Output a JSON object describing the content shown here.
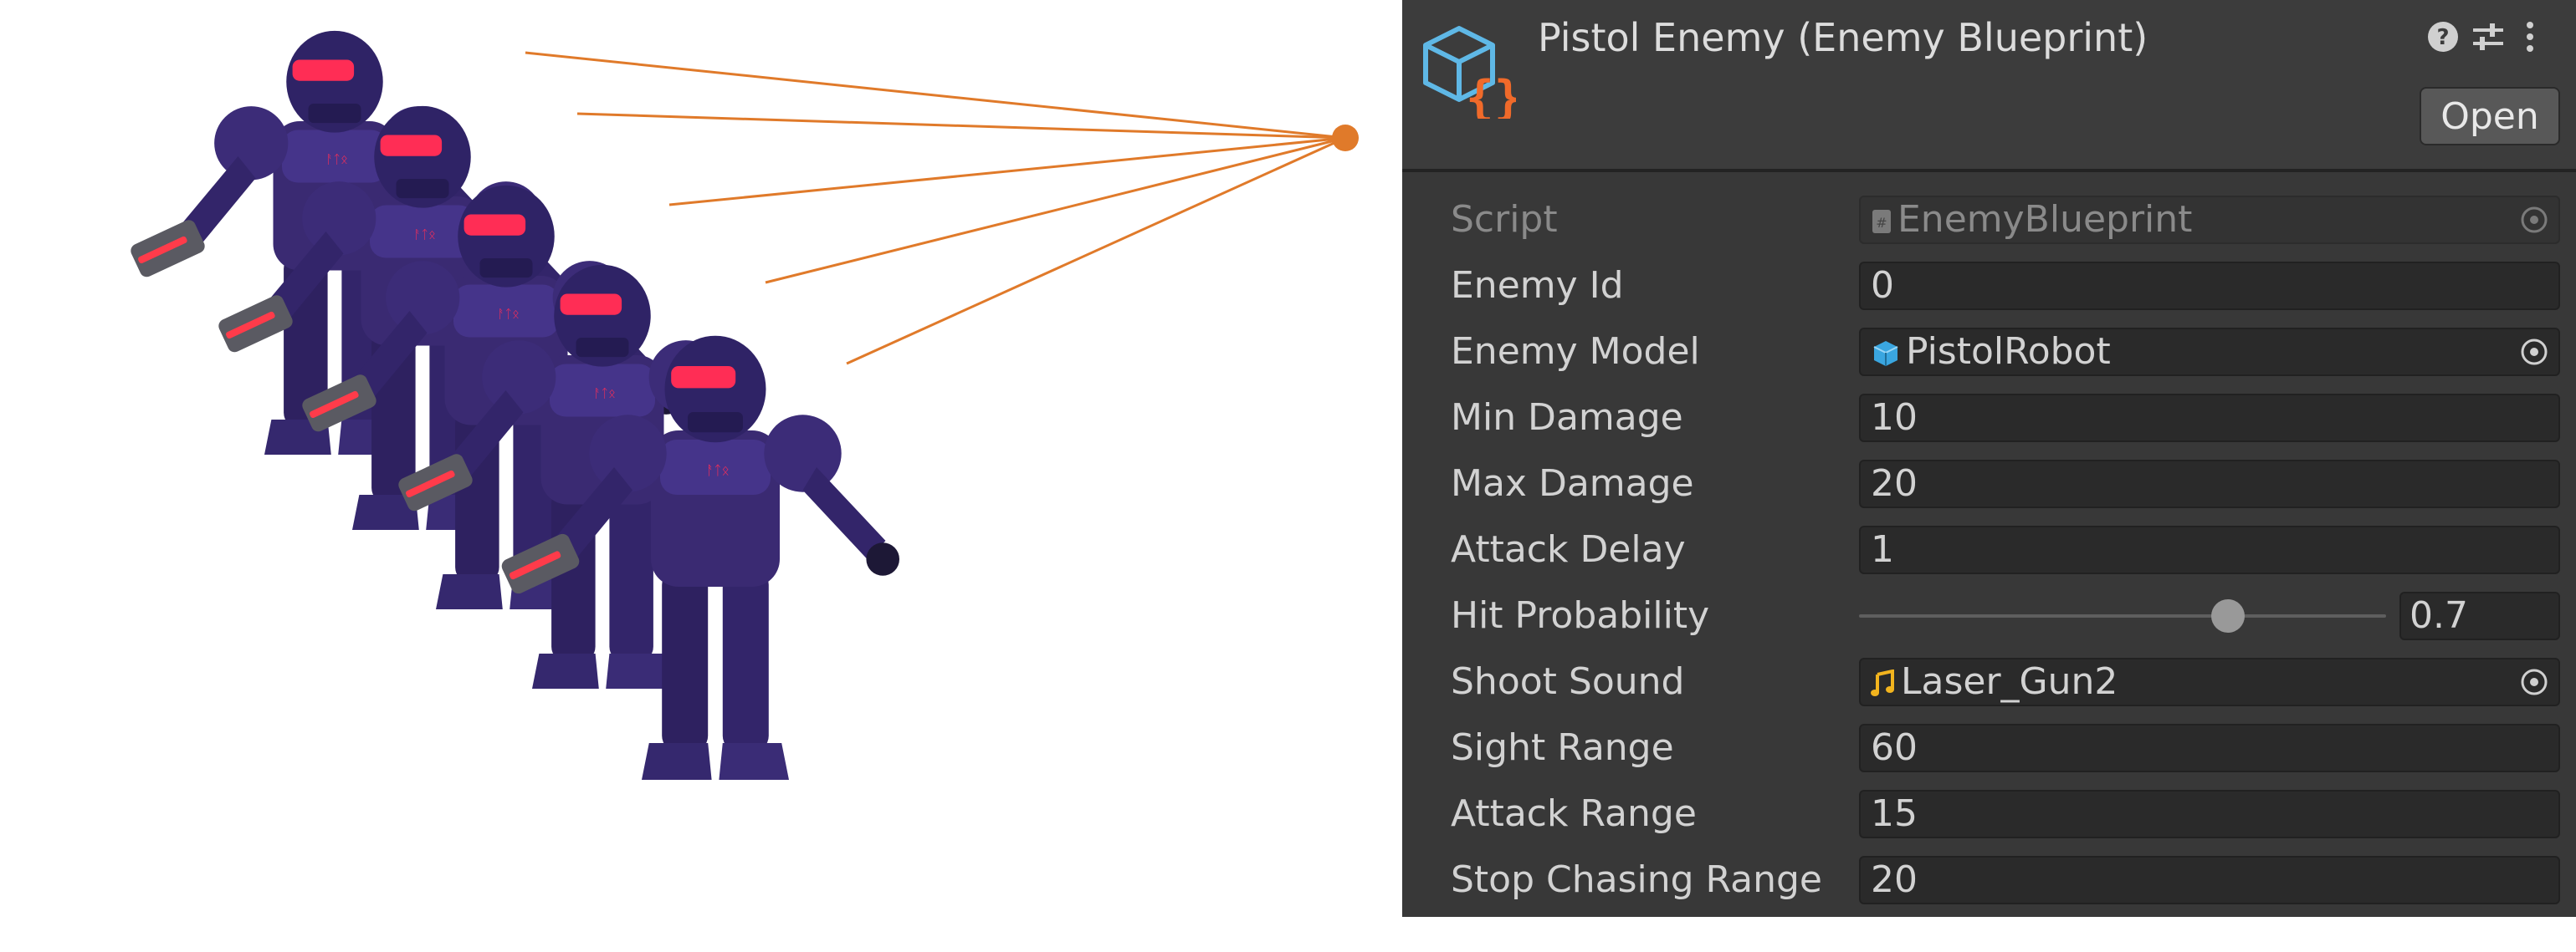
{
  "header": {
    "title": "Pistol Enemy (Enemy Blueprint)",
    "open_label": "Open"
  },
  "fields": {
    "script": {
      "label": "Script",
      "value": "EnemyBlueprint"
    },
    "enemy_id": {
      "label": "Enemy Id",
      "value": "0"
    },
    "enemy_model": {
      "label": "Enemy Model",
      "value": "PistolRobot",
      "icon": "cube-icon"
    },
    "min_damage": {
      "label": "Min Damage",
      "value": "10"
    },
    "max_damage": {
      "label": "Max Damage",
      "value": "20"
    },
    "attack_delay": {
      "label": "Attack Delay",
      "value": "1"
    },
    "hit_probability": {
      "label": "Hit Probability",
      "value": "0.7",
      "fraction": 0.7
    },
    "shoot_sound": {
      "label": "Shoot Sound",
      "value": "Laser_Gun2",
      "icon": "audio-clip-icon"
    },
    "sight_range": {
      "label": "Sight Range",
      "value": "60"
    },
    "attack_range": {
      "label": "Attack Range",
      "value": "15"
    },
    "stop_chasing_range": {
      "label": "Stop Chasing Range",
      "value": "20"
    }
  },
  "colors": {
    "inspector_bg": "#383838",
    "field_bg": "#2a2a2a",
    "sight_line": "#e07a2a",
    "robot_body": "#3a2a72",
    "visor": "#ff2d55"
  }
}
